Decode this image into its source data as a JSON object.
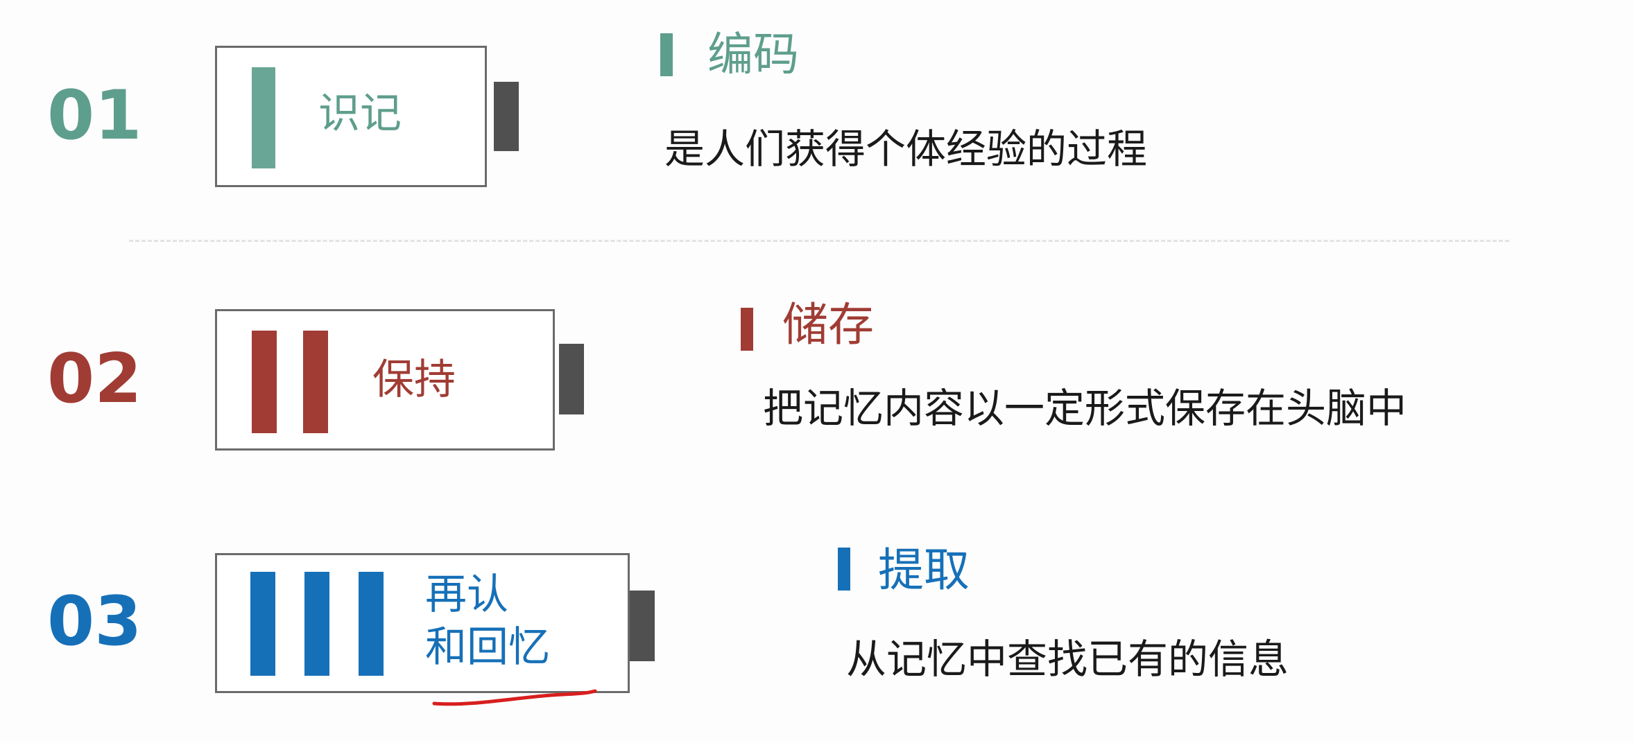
{
  "colors": {
    "teal": "#5e9e8c",
    "red": "#a03c34",
    "blue": "#1670b8",
    "battery_cap": "#505050",
    "annotation_red": "#d81e1e"
  },
  "rows": [
    {
      "number": "01",
      "label": "识记",
      "section_title": "编码",
      "description": "是人们获得个体经验的过程",
      "bar_count": 1
    },
    {
      "number": "02",
      "label": "保持",
      "section_title": "储存",
      "description": "把记忆内容以一定形式保存在头脑中",
      "bar_count": 2
    },
    {
      "number": "03",
      "label_line1": "再认",
      "label_line2": "和回忆",
      "section_title": "提取",
      "description": "从记忆中查找已有的信息",
      "bar_count": 3
    }
  ]
}
